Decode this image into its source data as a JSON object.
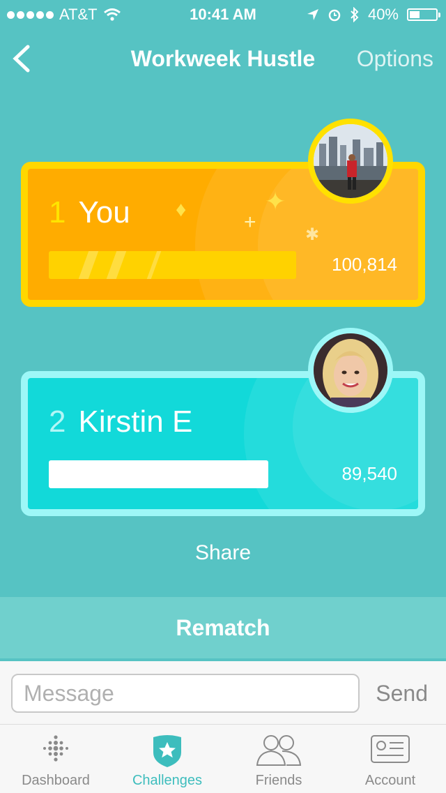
{
  "status_bar": {
    "carrier": "AT&T",
    "time": "10:41 AM",
    "battery": "40%",
    "battery_level": 0.4
  },
  "nav": {
    "title": "Workweek Hustle",
    "options_label": "Options",
    "back_icon": "chevron-left-icon"
  },
  "leaderboard": [
    {
      "rank": "1",
      "name": "You",
      "score": "100,814",
      "progress": 1.0
    },
    {
      "rank": "2",
      "name": "Kirstin E",
      "score": "89,540",
      "progress": 0.888
    }
  ],
  "share_label": "Share",
  "rematch_label": "Rematch",
  "composer": {
    "placeholder": "Message",
    "send_label": "Send"
  },
  "tabbar": {
    "items": [
      {
        "label": "Dashboard",
        "icon": "dots-grid-icon"
      },
      {
        "label": "Challenges",
        "icon": "star-badge-icon",
        "active": true
      },
      {
        "label": "Friends",
        "icon": "people-icon"
      },
      {
        "label": "Account",
        "icon": "id-card-icon"
      }
    ]
  },
  "colors": {
    "background": "#56c3c3",
    "first_place": "#ffac00",
    "first_border": "#ffd700",
    "second_place": "#12d9d9",
    "second_border": "#9df7f7",
    "tab_active": "#3dbdbd"
  }
}
